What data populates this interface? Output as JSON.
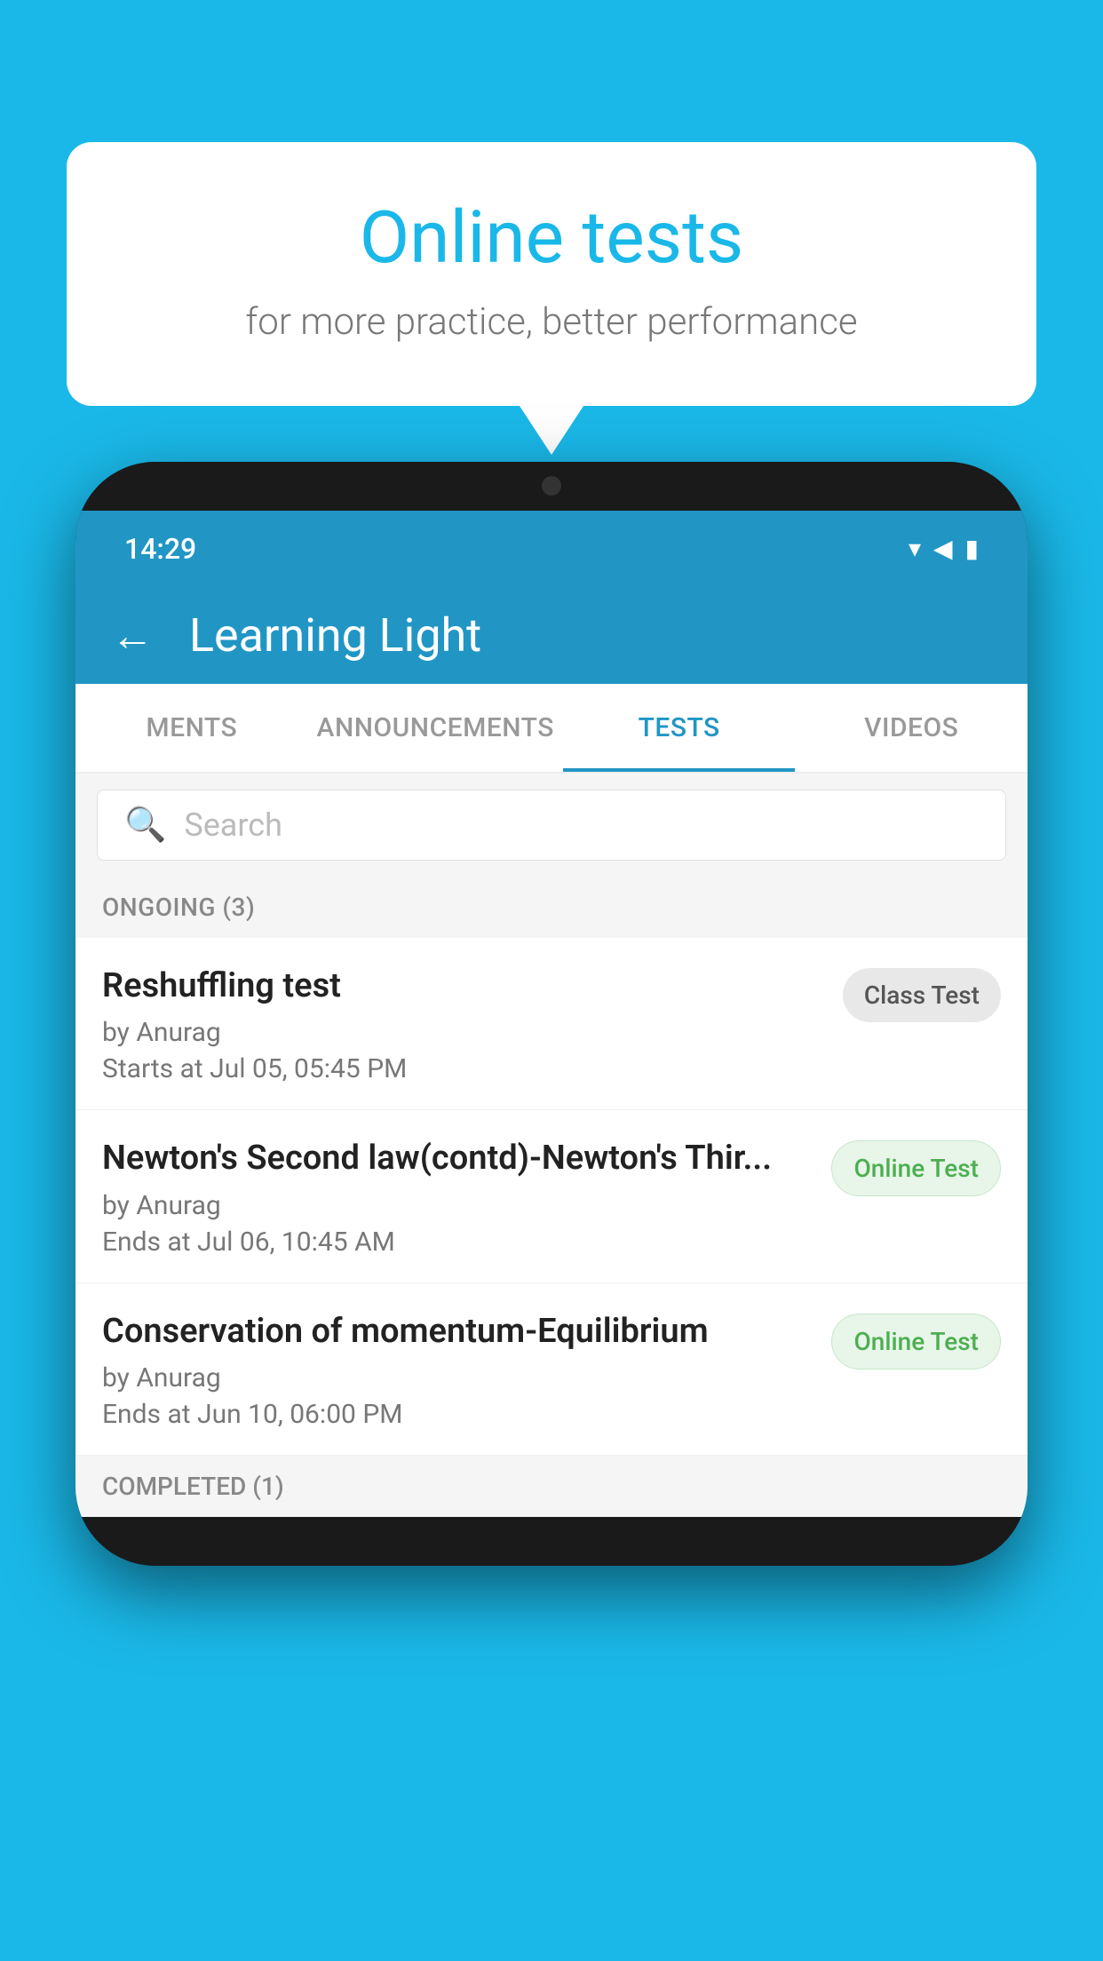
{
  "bubble": {
    "title": "Online tests",
    "subtitle": "for more practice, better performance"
  },
  "status_bar": {
    "time": "14:29",
    "wifi_icon": "▾",
    "signal_icon": "◀",
    "battery_icon": "▮"
  },
  "app_bar": {
    "title": "Learning Light",
    "back_label": "←"
  },
  "tabs": [
    {
      "label": "MENTS",
      "active": false
    },
    {
      "label": "ANNOUNCEMENTS",
      "active": false
    },
    {
      "label": "TESTS",
      "active": true
    },
    {
      "label": "VIDEOS",
      "active": false
    }
  ],
  "search": {
    "placeholder": "Search"
  },
  "ongoing_section": {
    "label": "ONGOING (3)"
  },
  "test_items": [
    {
      "name": "Reshuffling test",
      "by": "by Anurag",
      "time": "Starts at  Jul 05, 05:45 PM",
      "badge": "Class Test",
      "badge_type": "class"
    },
    {
      "name": "Newton's Second law(contd)-Newton's Thir...",
      "by": "by Anurag",
      "time": "Ends at  Jul 06, 10:45 AM",
      "badge": "Online Test",
      "badge_type": "online"
    },
    {
      "name": "Conservation of momentum-Equilibrium",
      "by": "by Anurag",
      "time": "Ends at  Jun 10, 06:00 PM",
      "badge": "Online Test",
      "badge_type": "online"
    }
  ],
  "completed_section": {
    "label": "COMPLETED (1)"
  }
}
